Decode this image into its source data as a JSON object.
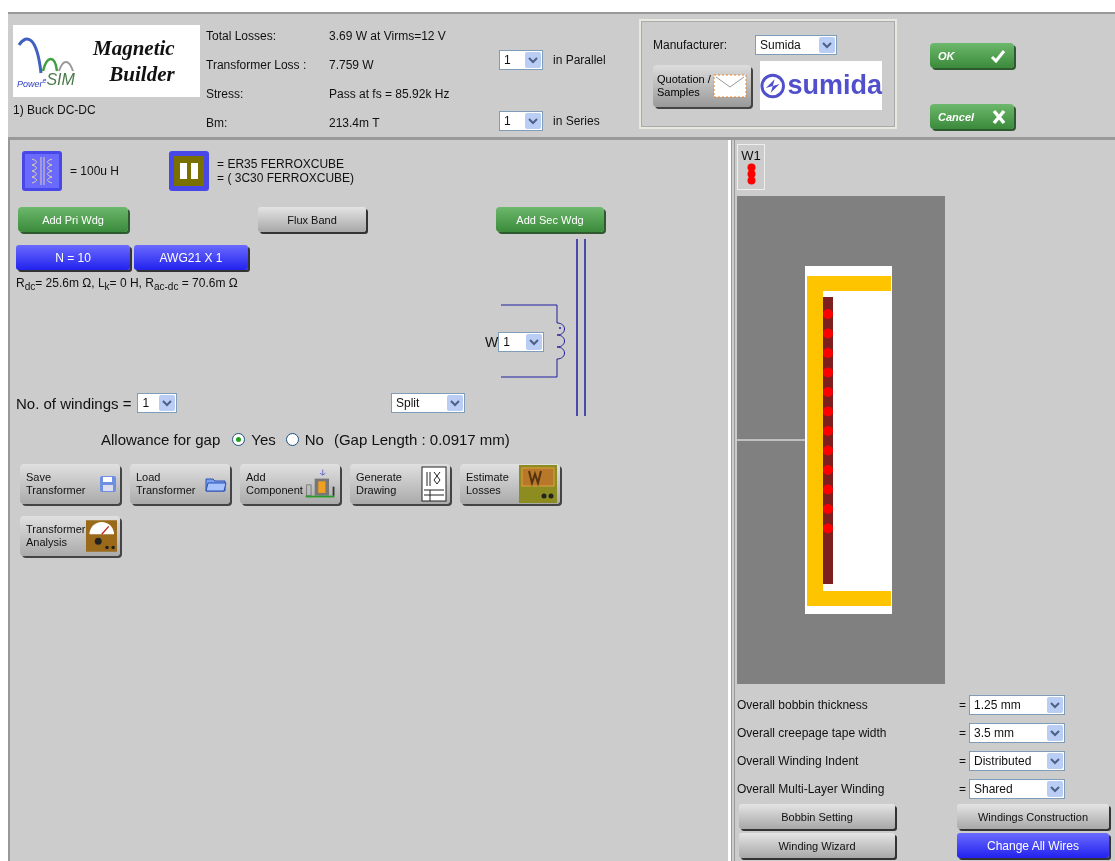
{
  "header": {
    "logo": {
      "title_line1": "Magnetic",
      "title_line2": "Builder",
      "brand_prefix": "Power",
      "brand_superscript": "e",
      "brand_suffix": "SIM"
    },
    "topology": "1) Buck DC-DC",
    "summary": [
      {
        "label": "Total Losses:",
        "value": "3.69 W  at Virms=12 V"
      },
      {
        "label": "Transformer Loss :",
        "value": "7.759 W"
      },
      {
        "label": "Stress:",
        "value": "Pass at fs = 85.92k Hz"
      },
      {
        "label": "Bm:",
        "value": "213.4m T"
      }
    ],
    "parallel": {
      "value": "1",
      "label": "in Parallel"
    },
    "series": {
      "value": "1",
      "label": "in Series"
    },
    "manufacturer": {
      "label": "Manufacturer:",
      "value": "Sumida",
      "logo_text": "sumida",
      "quotation_lines": [
        "Quotation /",
        "Samples"
      ]
    },
    "ok_button": "OK",
    "cancel_button": "Cancel"
  },
  "design": {
    "inductance": "= 100u H",
    "core_lines": [
      "= ER35 FERROXCUBE",
      "= ( 3C30 FERROXCUBE)"
    ],
    "add_primary": "Add Pri Wdg",
    "flux_band": "Flux Band",
    "add_secondary": "Add Sec Wdg",
    "turns": "N = 10",
    "wire": "AWG21 X 1",
    "resistance": "R$_{dc}$= 25.6m Ω, L$_{k}$= 0 H, R$_{ac-dc}$ = 70.6m Ω",
    "winding_label": "W",
    "winding_value": "1",
    "windings_count": {
      "label": "No. of windings =",
      "value": "1"
    },
    "arrangement": "Split",
    "gap": {
      "label": "Allowance for gap",
      "options": [
        {
          "label": "Yes",
          "selected": true
        },
        {
          "label": "No",
          "selected": false
        }
      ],
      "note": "(Gap Length : 0.0917 mm)"
    },
    "actions": [
      {
        "kind": "save",
        "lines": [
          "Save",
          "Transformer"
        ]
      },
      {
        "kind": "load",
        "lines": [
          "Load",
          "Transformer"
        ]
      },
      {
        "kind": "component",
        "lines": [
          "Add",
          "Component"
        ]
      },
      {
        "kind": "drawing",
        "lines": [
          "Generate",
          "Drawing"
        ]
      },
      {
        "kind": "losses",
        "lines": [
          "Estimate",
          "Losses"
        ]
      },
      {
        "kind": "analysis",
        "lines": [
          "Transformer",
          "Analysis"
        ]
      }
    ]
  },
  "winding_view": {
    "legend": "W1",
    "settings": [
      {
        "label": "Overall bobbin thickness",
        "sign": "=",
        "value": "1.25 mm"
      },
      {
        "label": "Overall creepage tape width",
        "sign": "=",
        "value": "3.5 mm"
      },
      {
        "label": "Overall Winding Indent",
        "sign": "=",
        "value": "Distributed"
      },
      {
        "label": "Overall Multi-Layer Winding",
        "sign": "=",
        "value": "Shared"
      }
    ],
    "buttons": [
      {
        "kind": "gray",
        "label": "Bobbin Setting"
      },
      {
        "kind": "gray",
        "label": "Windings Construction"
      },
      {
        "kind": "gray",
        "label": "Winding Wizard"
      },
      {
        "kind": "blue",
        "label": "Change All Wires"
      }
    ]
  }
}
